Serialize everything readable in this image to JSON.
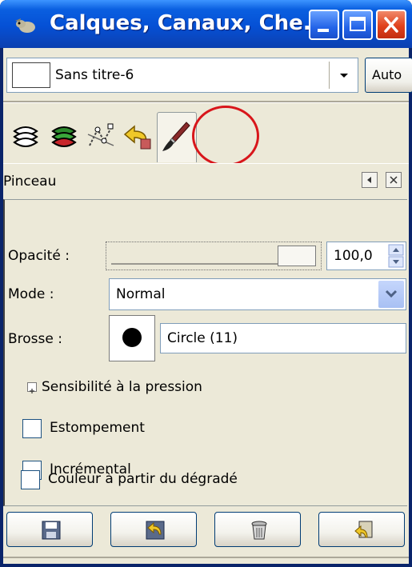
{
  "window": {
    "title": "Calques, Canaux, Che...",
    "icon": "gimp-wilber-icon",
    "controls": [
      "minimize-icon",
      "maximize-icon",
      "close-icon"
    ]
  },
  "image_selector": {
    "value": "Sans titre-6",
    "auto_label": "Auto"
  },
  "tabs": [
    {
      "icon": "layers-icon"
    },
    {
      "icon": "channels-icon"
    },
    {
      "icon": "paths-icon"
    },
    {
      "icon": "undo-history-icon"
    },
    {
      "icon": "paintbrush-tool-icon",
      "active": true
    }
  ],
  "panel": {
    "title": "Pinceau",
    "opacity_label": "Opacité :",
    "opacity_value": "100,0",
    "opacity_fraction": 1.0,
    "mode_label": "Mode :",
    "mode_value": "Normal",
    "brush_label": "Brosse :",
    "brush_value": "Circle (11)",
    "pressure_label": "Sensibilité à la pression",
    "options": [
      {
        "label": "Estompement",
        "checked": false
      },
      {
        "label": "Incrémental",
        "checked": false
      },
      {
        "label": "Couleur à partir du dégradé",
        "checked": false
      }
    ]
  },
  "bottom_buttons": [
    {
      "icon": "save-options-icon"
    },
    {
      "icon": "restore-options-icon"
    },
    {
      "icon": "delete-options-icon"
    },
    {
      "icon": "reset-options-icon"
    }
  ],
  "colors": {
    "titlebar": "#0550d5",
    "dialog_bg": "#ece9d8",
    "highlight_circle": "#d8161b"
  }
}
